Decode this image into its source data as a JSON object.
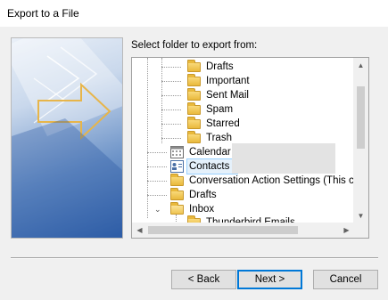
{
  "window": {
    "title": "Export to a File"
  },
  "prompt": "Select folder to export from:",
  "tree": {
    "items": [
      {
        "label": "Drafts",
        "icon": "folder-icon"
      },
      {
        "label": "Important",
        "icon": "folder-icon"
      },
      {
        "label": "Sent Mail",
        "icon": "folder-icon"
      },
      {
        "label": "Spam",
        "icon": "folder-icon"
      },
      {
        "label": "Starred",
        "icon": "folder-icon"
      },
      {
        "label": "Trash",
        "icon": "folder-icon"
      },
      {
        "label": "Calendar",
        "icon": "calendar-icon"
      },
      {
        "label": "Contacts (",
        "icon": "contacts-icon"
      },
      {
        "label": "Conversation Action Settings (This c",
        "icon": "folder-icon"
      },
      {
        "label": "Drafts",
        "icon": "folder-icon"
      },
      {
        "label": "Inbox",
        "icon": "folder-open-icon"
      },
      {
        "label": "Thunderbird Emails",
        "icon": "folder-icon"
      }
    ]
  },
  "buttons": {
    "back": "< Back",
    "next": "Next >",
    "cancel": "Cancel"
  }
}
